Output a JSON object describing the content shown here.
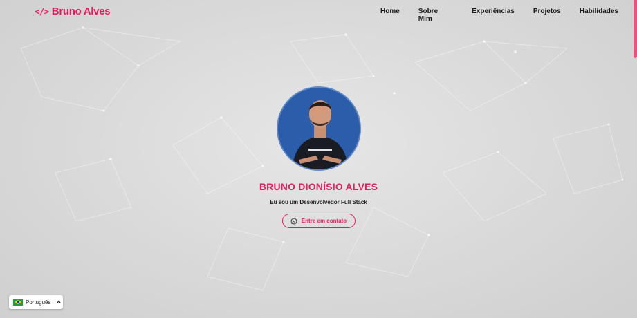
{
  "brand": {
    "code_symbol": "</>",
    "name": "Bruno Alves",
    "accent_color": "#e11d5f"
  },
  "nav": {
    "items": [
      {
        "label": "Home"
      },
      {
        "label": "Sobre Mim"
      },
      {
        "label": "Experiências"
      },
      {
        "label": "Projetos"
      },
      {
        "label": "Habilidades"
      }
    ]
  },
  "hero": {
    "name": "BRUNO DIONÍSIO ALVES",
    "subtitle": "Eu sou um Desenvolvedor Full Stack",
    "cta_label": "Entre em contato",
    "cta_icon": "whatsapp-icon",
    "avatar_alt": "profile-photo"
  },
  "language": {
    "selected": "Português",
    "flag": "brazil-flag-icon",
    "toggle_icon": "chevron-up-icon"
  }
}
